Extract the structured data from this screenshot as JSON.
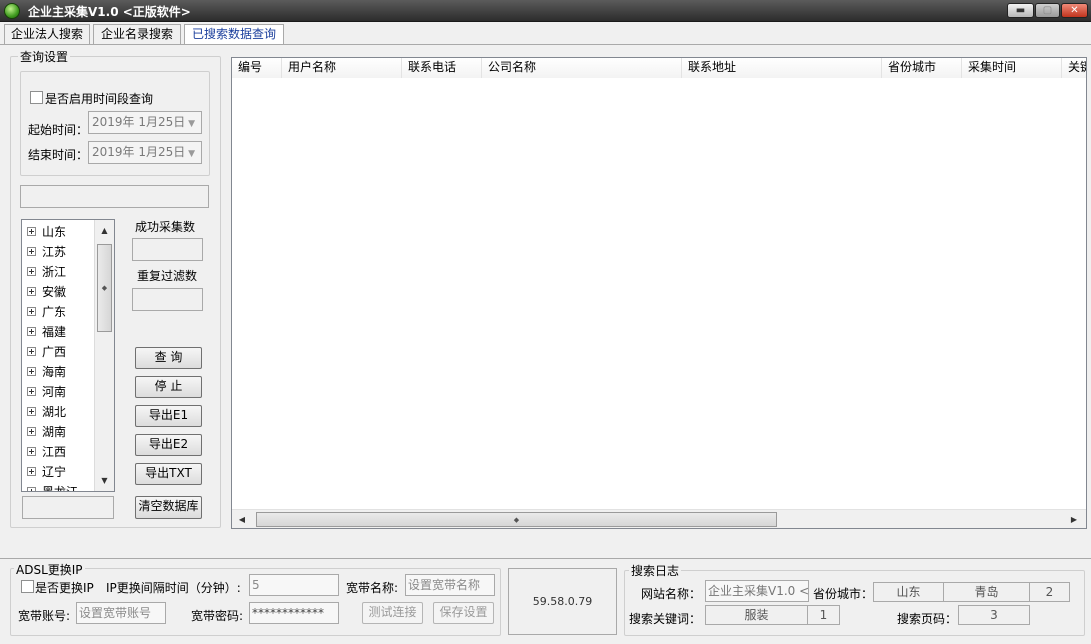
{
  "window": {
    "title": "企业主采集V1.0 <正版软件>",
    "btn_min": "▬",
    "btn_max": "▢",
    "btn_close": "✕"
  },
  "tabs": [
    {
      "label": "企业法人搜索",
      "active": false
    },
    {
      "label": "企业名录搜索",
      "active": false
    },
    {
      "label": "已搜索数据查询",
      "active": true
    }
  ],
  "query": {
    "group_label": "查询设置",
    "enable_time_label": "是否启用时间段查询",
    "start_label": "起始时间：",
    "start_value": "2019年 1月25日",
    "end_label": "结束时间：",
    "end_value": "2019年 1月25日"
  },
  "provinces": [
    "山东",
    "江苏",
    "浙江",
    "安徽",
    "广东",
    "福建",
    "广西",
    "海南",
    "河南",
    "湖北",
    "湖南",
    "江西",
    "辽宁",
    "黑龙江"
  ],
  "stats": {
    "success_label": "成功采集数",
    "dup_label": "重复过滤数"
  },
  "actions": {
    "query": "查 询",
    "stop": "停 止",
    "export_e1": "导出E1",
    "export_e2": "导出E2",
    "export_txt": "导出TXT",
    "clear_db": "清空数据库"
  },
  "table": {
    "columns": [
      "编号",
      "用户名称",
      "联系电话",
      "公司名称",
      "联系地址",
      "省份城市",
      "采集时间",
      "关键"
    ],
    "rows": []
  },
  "adsl": {
    "group_label": "ADSL更换IP",
    "change_ip_label": "是否更换IP",
    "interval_label": "IP更换间隔时间（分钟）:",
    "interval_value": "5",
    "bb_name_label": "宽带名称:",
    "bb_name_placeholder": "设置宽带名称",
    "bb_account_label": "宽带账号:",
    "bb_account_placeholder": "设置宽带账号",
    "bb_pass_label": "宽带密码:",
    "bb_pass_value": "************",
    "test_btn": "测试连接",
    "save_btn": "保存设置",
    "ip": "59.58.0.79"
  },
  "log": {
    "group_label": "搜索日志",
    "site_label": "网站名称：",
    "site_value": "企业主采集V1.0 <正",
    "prov_label": "省份城市：",
    "province": "山东",
    "city": "青岛",
    "city_index": "2",
    "keyword_label": "搜索关键词：",
    "keyword": "服装",
    "keyword_index": "1",
    "page_label": "搜索页码：",
    "page": "3"
  }
}
